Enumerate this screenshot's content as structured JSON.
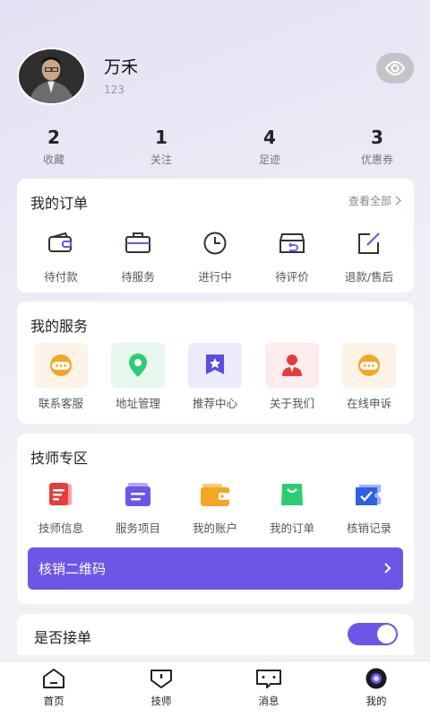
{
  "profile": {
    "name": "万禾",
    "uid": "123"
  },
  "stats": [
    {
      "value": "2",
      "label": "收藏"
    },
    {
      "value": "1",
      "label": "关注"
    },
    {
      "value": "4",
      "label": "足迹"
    },
    {
      "value": "3",
      "label": "优惠券"
    }
  ],
  "orders": {
    "title": "我的订单",
    "view_all": "查看全部",
    "items": [
      {
        "label": "待付款",
        "icon": "wallet-icon"
      },
      {
        "label": "待服务",
        "icon": "briefcase-icon"
      },
      {
        "label": "进行中",
        "icon": "clock-icon"
      },
      {
        "label": "待评价",
        "icon": "return-box-icon"
      },
      {
        "label": "退款/售后",
        "icon": "edit-icon"
      }
    ]
  },
  "services": {
    "title": "我的服务",
    "items": [
      {
        "label": "联系客服",
        "icon": "headset-icon"
      },
      {
        "label": "地址管理",
        "icon": "location-pin-icon"
      },
      {
        "label": "推荐中心",
        "icon": "star-badge-icon"
      },
      {
        "label": "关于我们",
        "icon": "person-icon"
      },
      {
        "label": "在线申诉",
        "icon": "headset-icon"
      }
    ]
  },
  "technician": {
    "title": "技师专区",
    "items": [
      {
        "label": "技师信息",
        "icon": "document-icon"
      },
      {
        "label": "服务项目",
        "icon": "list-icon"
      },
      {
        "label": "我的账户",
        "icon": "wallet-icon"
      },
      {
        "label": "我的订单",
        "icon": "shopping-bag-icon"
      },
      {
        "label": "核销记录",
        "icon": "ticket-check-icon"
      }
    ],
    "qr_button": "核销二维码"
  },
  "accept_orders": {
    "label": "是否接单",
    "enabled": true
  },
  "tabbar": [
    {
      "label": "首页",
      "icon": "home-icon"
    },
    {
      "label": "技师",
      "icon": "technician-icon"
    },
    {
      "label": "消息",
      "icon": "message-icon"
    },
    {
      "label": "我的",
      "icon": "profile-icon",
      "active": true
    }
  ],
  "colors": {
    "accent": "#6c56e6",
    "card": "#ffffff",
    "toggle_on": "#6c56e6"
  }
}
